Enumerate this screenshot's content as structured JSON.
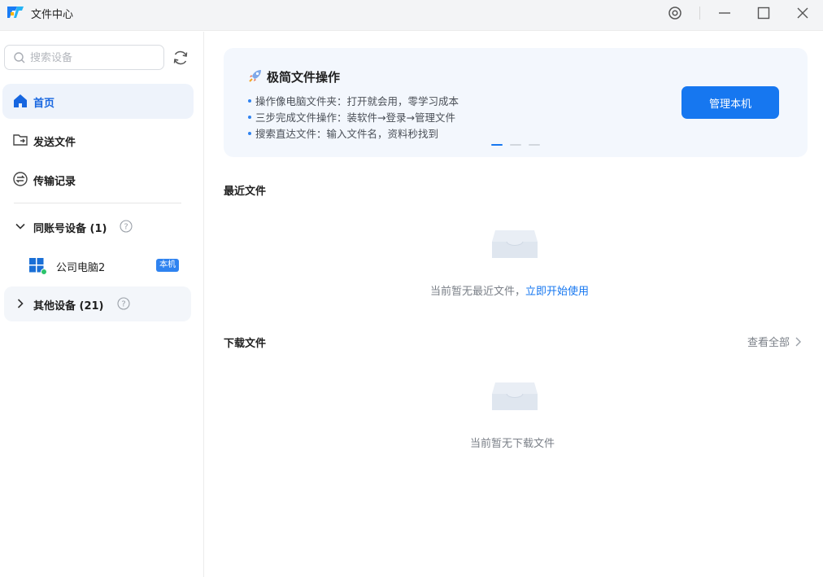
{
  "app": {
    "title": "文件中心"
  },
  "sidebar": {
    "search": {
      "placeholder": "搜索设备",
      "value": ""
    },
    "nav": [
      {
        "label": "首页",
        "icon": "home-icon",
        "active": true
      },
      {
        "label": "发送文件",
        "icon": "send-folder-icon",
        "active": false
      },
      {
        "label": "传输记录",
        "icon": "transfer-icon",
        "active": false
      }
    ],
    "groups": {
      "same_account": {
        "label": "同账号设备 (1)",
        "expanded": true
      },
      "others": {
        "label": "其他设备 (21)",
        "expanded": false
      }
    },
    "devices": [
      {
        "label": "公司电脑2",
        "badge": "本机",
        "status": "online"
      }
    ]
  },
  "banner": {
    "title": "极简文件操作",
    "lines": [
      "操作像电脑文件夹：打开就会用，零学习成本",
      "三步完成文件操作：装软件→登录→管理文件",
      "搜索直达文件：输入文件名，资料秒找到"
    ],
    "cta": "管理本机",
    "active_page": 1,
    "page_count": 3
  },
  "recent": {
    "title": "最近文件",
    "empty_text": "当前暂无最近文件，",
    "empty_link": "立即开始使用"
  },
  "downloads": {
    "title": "下载文件",
    "view_all": "查看全部",
    "empty_text": "当前暂无下载文件"
  },
  "colors": {
    "accent": "#1677f0",
    "active_nav_bg": "#eef3fb",
    "online": "#2bc46b"
  }
}
